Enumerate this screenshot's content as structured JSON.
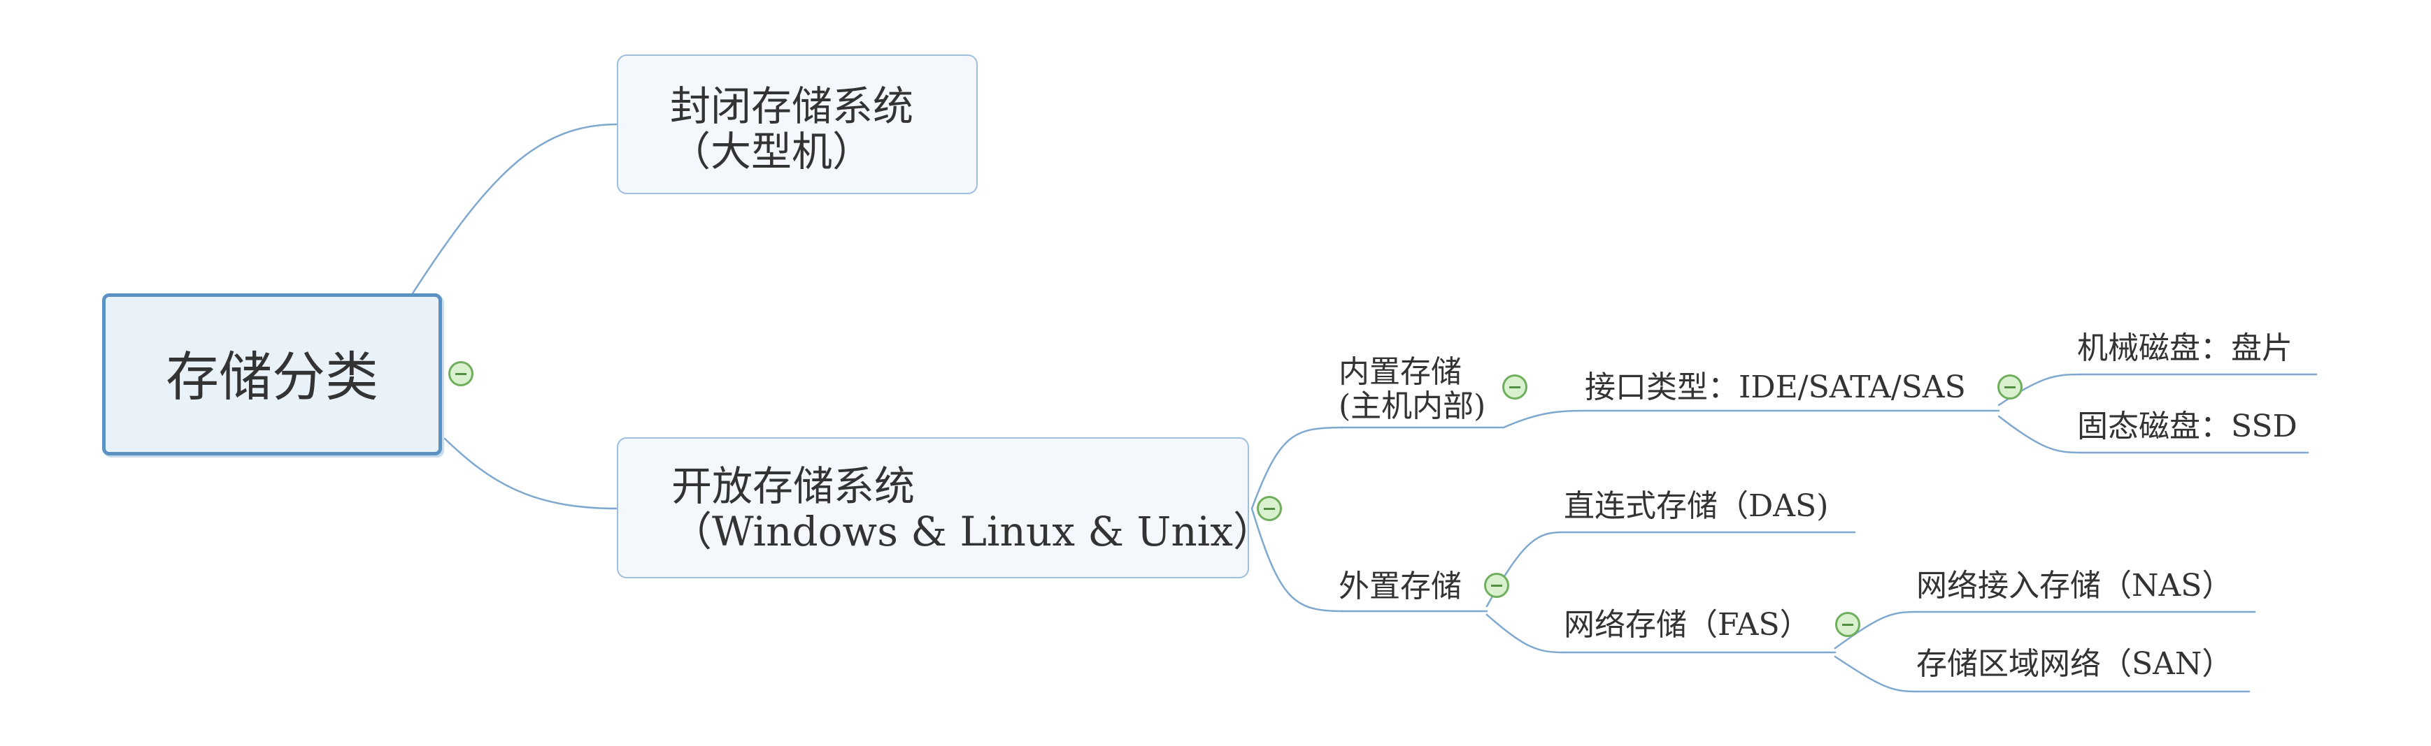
{
  "diagram": {
    "root": {
      "label": "存储分类"
    },
    "closed": {
      "line1": "封闭存储系统",
      "line2": "（大型机）"
    },
    "open": {
      "line1": "开放存储系统",
      "line2": "（Windows & Linux & Unix）"
    },
    "internal": {
      "line1": "内置存储",
      "line2": "(主机内部)"
    },
    "interface": {
      "label": "接口类型：IDE/SATA/SAS"
    },
    "mechanical": {
      "label": "机械磁盘：盘片"
    },
    "solid": {
      "label": "固态磁盘：SSD"
    },
    "external": {
      "label": "外置存储"
    },
    "das": {
      "label": "直连式存储（DAS)"
    },
    "fas": {
      "label": "网络存储（FAS）"
    },
    "nas": {
      "label": "网络接入存储（NAS）"
    },
    "san": {
      "label": "存储区域网络（SAN）"
    }
  },
  "colors": {
    "connector": "#7fa8cf",
    "box_fill": "#f4f8fc",
    "box_border": "#9fbfdc",
    "root_border": "#5a92c4",
    "collapse_border": "#6fae5c",
    "collapse_fill": "#d9f1cf"
  },
  "icons": {
    "collapse": "collapse-minus-icon"
  }
}
